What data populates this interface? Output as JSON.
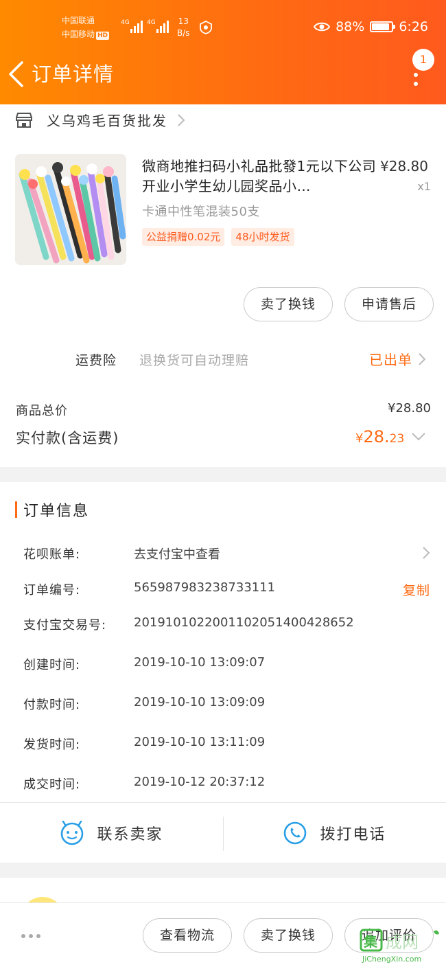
{
  "status_bar": {
    "carrier1": "中国联通",
    "carrier2": "中国移动",
    "hd": "HD",
    "net1": "4G",
    "net2": "4G",
    "speed_value": "13",
    "speed_unit": "B/s",
    "battery_text": "88%",
    "battery_level": 0.88,
    "time": "6:26"
  },
  "header": {
    "title": "订单详情",
    "badge_count": "1"
  },
  "store": {
    "name": "义乌鸡毛百货批发"
  },
  "product": {
    "name": "微商地推扫码小礼品批發1元以下公司开业小学生幼儿园奖品小…",
    "price": "¥28.80",
    "quantity": "x1",
    "spec": "卡通中性笔混装50支",
    "tags": [
      "公益捐赠0.02元",
      "48小时发货"
    ]
  },
  "product_actions": {
    "sell_for_cash": "卖了换钱",
    "after_sale": "申请售后"
  },
  "shipping_insurance": {
    "label": "运费险",
    "description": "退换货可自动理赔",
    "status": "已出单"
  },
  "totals": {
    "goods_total_label": "商品总价",
    "goods_total_value": "¥28.80",
    "paid_label": "实付款(含运费)",
    "paid_currency": "¥",
    "paid_integer": "28.",
    "paid_decimal": "23"
  },
  "order_info": {
    "title": "订单信息",
    "rows": [
      {
        "key": "花呗账单:",
        "value": "去支付宝中查看"
      },
      {
        "key": "订单编号:",
        "value": "565987983238733111",
        "action": "复制"
      },
      {
        "key": "支付宝交易号:",
        "value": "2019101022001102051400428652"
      },
      {
        "key": "创建时间:",
        "value": "2019-10-10 13:09:07"
      },
      {
        "key": "付款时间:",
        "value": "2019-10-10 13:09:09"
      },
      {
        "key": "发货时间:",
        "value": "2019-10-10 13:11:09"
      },
      {
        "key": "成交时间:",
        "value": "2019-10-12 20:37:12"
      }
    ]
  },
  "contact": {
    "seller": "联系卖家",
    "call": "拨打电话"
  },
  "bottom_actions": {
    "logistics": "查看物流",
    "sell_for_cash": "卖了换钱",
    "add_review": "追加评价"
  },
  "watermark": {
    "brand": "集成网",
    "url": "JiChengXin.com"
  },
  "colors": {
    "accent": "#ff6a12",
    "header_start": "#ff8a00",
    "header_end": "#ff5a1e",
    "tag_bg": "#ffece3"
  }
}
